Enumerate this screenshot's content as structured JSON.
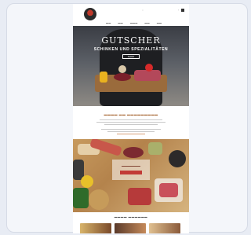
{
  "hero": {
    "title": "GUTSCHER",
    "subtitle": "SCHINKEN UND SPEZIALITÄTEN",
    "button": "SHOP"
  },
  "colors": {
    "accent": "#a5632f",
    "brand_red": "#c23a36"
  }
}
